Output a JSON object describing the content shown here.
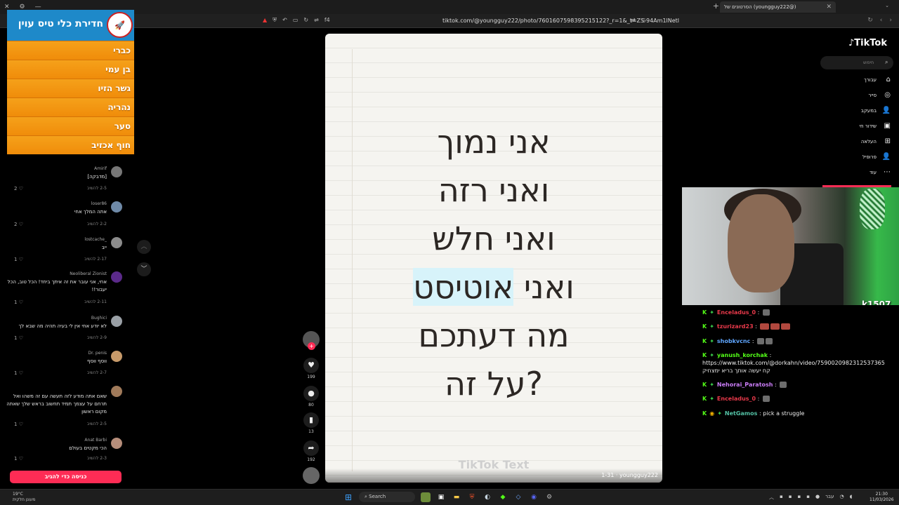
{
  "browser": {
    "tab_title": "(@youngguy222) הסרטונים של",
    "tab_close": "✕",
    "new_tab": "+",
    "url": "tiktok.com/@youngguy222/photo/7601607598395215122?_r=1&_t=ZS-94Am1lNetl",
    "extension_badge": "f4"
  },
  "banner": {
    "title": "חדירת כלי טיס עוין",
    "logo_text": "🚀",
    "rows": [
      "כברי",
      "בן עמי",
      "גשר הזיו",
      "נהריה",
      "סער",
      "חוף אכזיב"
    ]
  },
  "comments": [
    {
      "user": "Amirif",
      "text": "[מדבקה]",
      "date": "2-5",
      "reply": "להשיב",
      "likes": "2"
    },
    {
      "user": "loser86",
      "text": "אתה המלך אחי",
      "date": "2-2",
      "reply": "להשיב",
      "likes": "2"
    },
    {
      "user": "_lostcache",
      "text": "ייב",
      "date": "2-17",
      "reply": "להשיב",
      "likes": "1"
    },
    {
      "user": "Neoliberal Zionist",
      "text": "אחי, אני עובר את זה איתך ביחד! הכל טוב, הכל יעבור!!",
      "date": "2-11",
      "reply": "להשיב",
      "likes": "1"
    },
    {
      "user": "Bughici",
      "text": "לא יודע אחי אין לי בעיה תהיה מה שבא לך",
      "date": "2-9",
      "reply": "להשיב",
      "likes": "1"
    },
    {
      "user": "Dr. penis",
      "text": "ווסף ווסף",
      "date": "2-7",
      "reply": "להשיב",
      "likes": "1"
    },
    {
      "user": "",
      "text": "שאם אתה מודע לזה תעשה עם זה משהו ואל תרחם על עצמך תמיד תחשוב בראש שלך שאתה מקום ראשון",
      "date": "2-5",
      "reply": "להשיב",
      "likes": "1"
    },
    {
      "user": "Anat Barbi",
      "text": "הכי מקטים בעולם",
      "date": "2-3",
      "reply": "להשיב",
      "likes": "1"
    }
  ],
  "login_button": "כניסה כדי להגיב",
  "post": {
    "lines": [
      "אני נמוך",
      "ואני רזה",
      "ואני חלש",
      "ואני אוטיסט",
      "מה דעתכם",
      "?על זה"
    ],
    "highlight_word": "אוטיסט",
    "highlight_prefix": "ואני ",
    "watermark": "TikTok Text",
    "meta": "1-31 · youngguy222"
  },
  "actions": {
    "likes": "199",
    "comments": "80",
    "saves": "13",
    "shares": "192"
  },
  "tiktok_nav": {
    "logo": "TikTok",
    "search_placeholder": "חיפוש",
    "items": [
      {
        "label": "עבורך",
        "icon": "⌂"
      },
      {
        "label": "סייר",
        "icon": "◎"
      },
      {
        "label": "במעקב",
        "icon": "👤"
      },
      {
        "label": "שידור חי",
        "icon": "▣"
      },
      {
        "label": "העלאה",
        "icon": "⊞"
      },
      {
        "label": "פרופיל",
        "icon": "👤"
      },
      {
        "label": "עוד",
        "icon": "⋯"
      }
    ]
  },
  "webcam_tag": "k1507",
  "chat": [
    {
      "user": "Enceladus_0",
      "color": "#e8394a",
      "text": ""
    },
    {
      "user": "tzurizard23",
      "color": "#e8394a",
      "text": ""
    },
    {
      "user": "shobkvcnc",
      "color": "#5fa6ff",
      "text": ""
    },
    {
      "user": "yanush_korchak",
      "color": "#53fc18",
      "text": ""
    },
    {
      "user": "",
      "color": "#eeeeee",
      "text": "https://www.tiktok.com/@dorkahn/video/7590020982312537365"
    },
    {
      "user": "",
      "color": "#eeeeee",
      "text": "קח יעשה אותך בריא ימצחיק"
    },
    {
      "user": "Nehorai_Paratosh",
      "color": "#c97cf6",
      "text": ""
    },
    {
      "user": "Enceladus_0",
      "color": "#e8394a",
      "text": ""
    },
    {
      "user": "NetGamos",
      "color": "#53c0a4",
      "text": "pick a struggle"
    }
  ],
  "taskbar": {
    "weather_temp": "19°C",
    "weather_desc": "מעונן חלקית",
    "search": "Search",
    "time": "21:30",
    "date": "11/03/2026",
    "lang": "עבר"
  }
}
